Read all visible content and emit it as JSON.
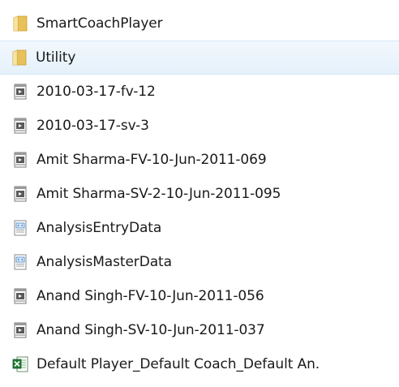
{
  "file_list": {
    "items": [
      {
        "name": "SmartCoachPlayer",
        "icon": "folder-icon"
      },
      {
        "name": "Utility",
        "icon": "folder-icon",
        "selected": true
      },
      {
        "name": "2010-03-17-fv-12",
        "icon": "video-file-icon"
      },
      {
        "name": "2010-03-17-sv-3",
        "icon": "video-file-icon"
      },
      {
        "name": "Amit Sharma-FV-10-Jun-2011-069",
        "icon": "video-file-icon"
      },
      {
        "name": "Amit Sharma-SV-2-10-Jun-2011-095",
        "icon": "video-file-icon"
      },
      {
        "name": "AnalysisEntryData",
        "icon": "xml-file-icon"
      },
      {
        "name": "AnalysisMasterData",
        "icon": "xml-file-icon"
      },
      {
        "name": "Anand Singh-FV-10-Jun-2011-056",
        "icon": "video-file-icon"
      },
      {
        "name": "Anand Singh-SV-10-Jun-2011-037",
        "icon": "video-file-icon"
      },
      {
        "name": "Default Player_Default Coach_Default An.",
        "icon": "excel-file-icon"
      }
    ]
  },
  "colors": {
    "selection_background": "#e5f1fb",
    "selection_border": "#d3e6f8",
    "folder": "#e8c15a",
    "excel_green": "#1e7b34"
  }
}
